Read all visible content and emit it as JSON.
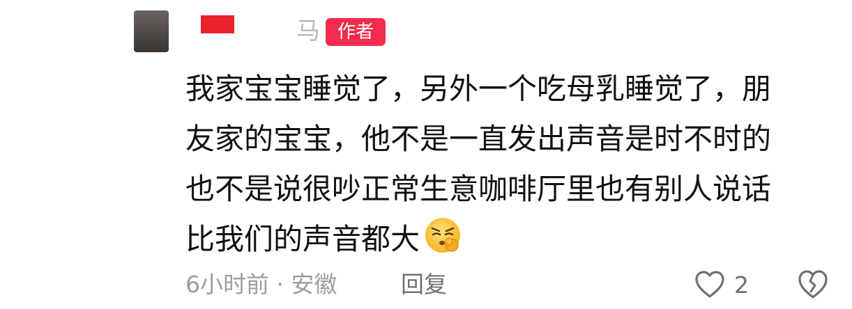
{
  "comment": {
    "author_name_visible": "马",
    "author_badge": "作者",
    "content_lines": [
      "我家宝宝睡觉了，另外一个吃母乳睡觉了，朋",
      "友家的宝宝，他不是一直发出声音是时不时的",
      "也不是说很吵正常生意咖啡厅里也有别人说话",
      "比我们的声音都大"
    ],
    "emoji": "pensive-shushing-emoji",
    "meta": "6小时前 · 安徽",
    "reply_label": "回复",
    "like_count": "2",
    "icons": {
      "like": "heart-outline-icon",
      "dislike": "broken-heart-icon"
    },
    "colors": {
      "badge": "#f32b4d",
      "name_redact": "#e8232c",
      "text": "#111111",
      "meta": "#9c9c9c"
    }
  }
}
